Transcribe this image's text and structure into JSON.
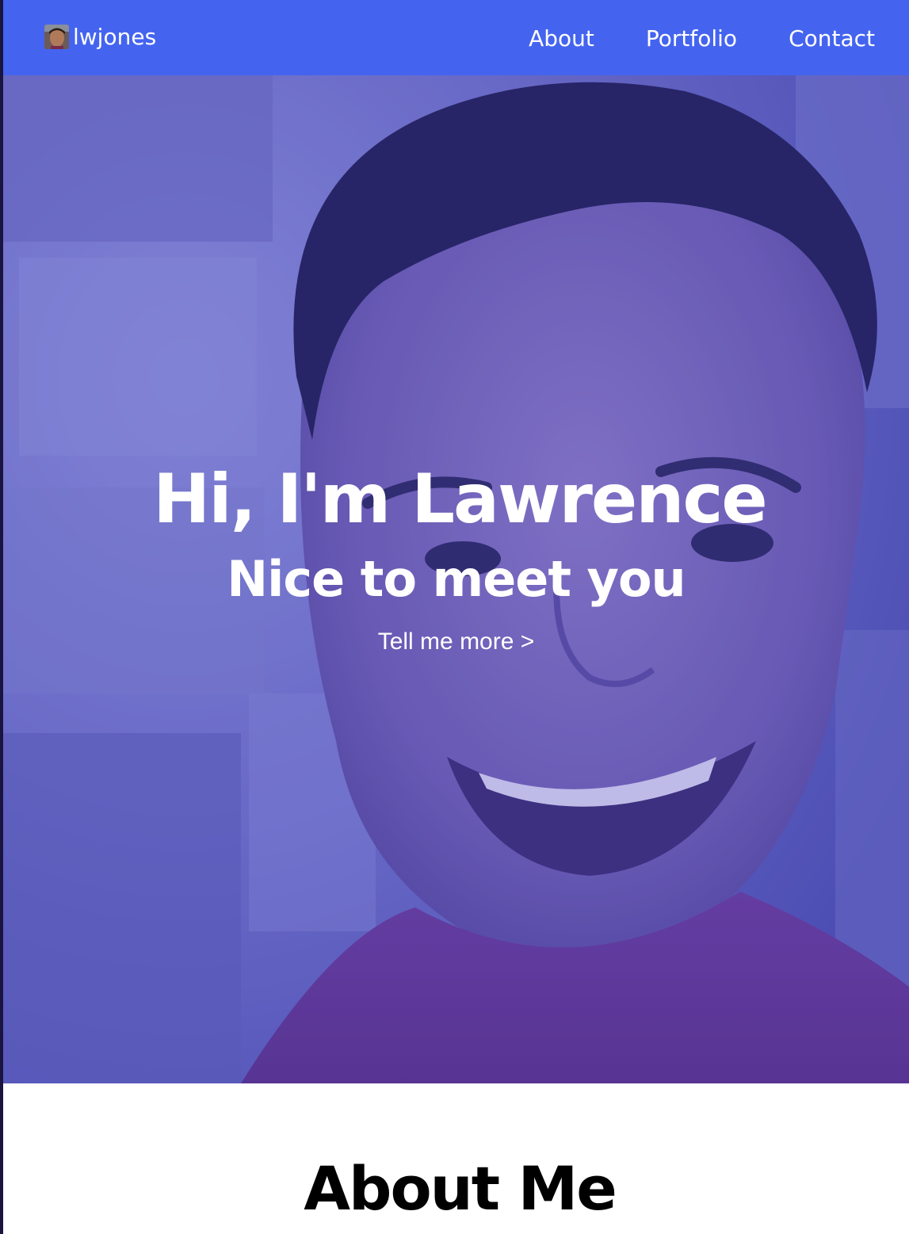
{
  "navbar": {
    "brand": "lwjones",
    "links": [
      {
        "label": "About"
      },
      {
        "label": "Portfolio"
      },
      {
        "label": "Contact"
      }
    ],
    "color": "#4464f0"
  },
  "hero": {
    "title": "Hi, I'm Lawrence",
    "subtitle": "Nice to meet you",
    "cta": "Tell me more >",
    "overlay_color": "#4b4fc8"
  },
  "about": {
    "title": "About Me"
  }
}
